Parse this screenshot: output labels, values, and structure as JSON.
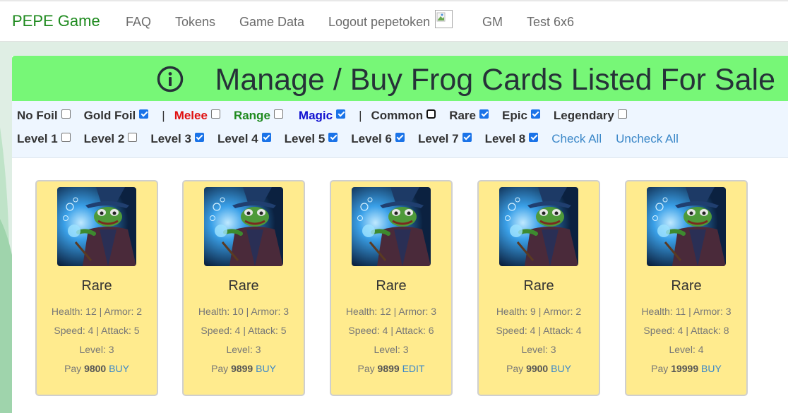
{
  "nav": {
    "brand": "PEPE Game",
    "items": [
      "FAQ",
      "Tokens",
      "Game Data",
      "Logout pepetoken",
      "GM",
      "Test 6x6"
    ]
  },
  "banner": {
    "title": "Manage / Buy Frog Cards Listed For Sale",
    "icon": "info-circle-icon"
  },
  "filters": {
    "row1": [
      {
        "label": "No Foil",
        "checked": false,
        "color": "#333333"
      },
      {
        "label": "Gold Foil",
        "checked": true,
        "color": "#333333"
      },
      {
        "label": "Melee",
        "checked": false,
        "color": "#e01010"
      },
      {
        "label": "Range",
        "checked": false,
        "color": "#1e8a1e"
      },
      {
        "label": "Magic",
        "checked": true,
        "color": "#1010d0"
      },
      {
        "label": "Common",
        "checked": false,
        "color": "#333333"
      },
      {
        "label": "Rare",
        "checked": true,
        "color": "#333333"
      },
      {
        "label": "Epic",
        "checked": true,
        "color": "#333333"
      },
      {
        "label": "Legendary",
        "checked": false,
        "color": "#333333"
      }
    ],
    "separator": "|",
    "row2": [
      {
        "label": "Level 1",
        "checked": false
      },
      {
        "label": "Level 2",
        "checked": false
      },
      {
        "label": "Level 3",
        "checked": true
      },
      {
        "label": "Level 4",
        "checked": true
      },
      {
        "label": "Level 5",
        "checked": true
      },
      {
        "label": "Level 6",
        "checked": true
      },
      {
        "label": "Level 7",
        "checked": true
      },
      {
        "label": "Level 8",
        "checked": true
      }
    ],
    "check_all": "Check All",
    "uncheck_all": "Uncheck All"
  },
  "cards": [
    {
      "rarity": "Rare",
      "line1": "Health: 12 | Armor: 2",
      "line2": "Speed: 4 | Attack: 5",
      "line3": "Level: 3",
      "pay_label": "Pay",
      "price": "9800",
      "action": "BUY"
    },
    {
      "rarity": "Rare",
      "line1": "Health: 10 | Armor: 3",
      "line2": "Speed: 4 | Attack: 5",
      "line3": "Level: 3",
      "pay_label": "Pay",
      "price": "9899",
      "action": "BUY"
    },
    {
      "rarity": "Rare",
      "line1": "Health: 12 | Armor: 3",
      "line2": "Speed: 4 | Attack: 6",
      "line3": "Level: 3",
      "pay_label": "Pay",
      "price": "9899",
      "action": "EDIT"
    },
    {
      "rarity": "Rare",
      "line1": "Health: 9 | Armor: 2",
      "line2": "Speed: 4 | Attack: 4",
      "line3": "Level: 3",
      "pay_label": "Pay",
      "price": "9900",
      "action": "BUY"
    },
    {
      "rarity": "Rare",
      "line1": "Health: 11 | Armor: 3",
      "line2": "Speed: 4 | Attack: 8",
      "line3": "Level: 4",
      "pay_label": "Pay",
      "price": "19999",
      "action": "BUY"
    }
  ],
  "colors": {
    "brand": "#1e8a1e",
    "banner": "#77f777",
    "card": "#ffeb8e",
    "link": "#3a87c8"
  }
}
